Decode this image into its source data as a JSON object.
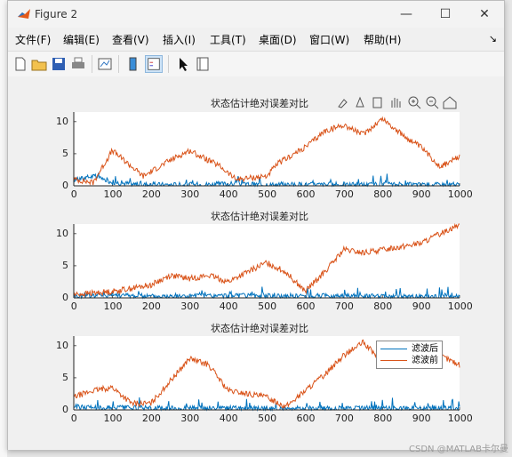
{
  "window": {
    "title": "Figure 2"
  },
  "menu": [
    "文件(F)",
    "编辑(E)",
    "查看(V)",
    "插入(I)",
    "工具(T)",
    "桌面(D)",
    "窗口(W)",
    "帮助(H)"
  ],
  "axes_toolbar_icons": [
    "brush-icon",
    "data-tip-icon",
    "legend-icon",
    "pan-icon",
    "zoom-in-icon",
    "zoom-out-icon",
    "home-icon"
  ],
  "watermark": "CSDN @MATLAB卡尔曼",
  "colors": {
    "filtered": "#0072BD",
    "raw": "#D95319"
  },
  "plots": [
    {
      "title": "状态估计绝对误差对比",
      "yticks": [
        "0",
        "5",
        "10"
      ],
      "xticks": [
        "0",
        "100",
        "200",
        "300",
        "400",
        "500",
        "600",
        "700",
        "800",
        "900",
        "1000"
      ]
    },
    {
      "title": "状态估计绝对误差对比",
      "yticks": [
        "0",
        "5",
        "10"
      ],
      "xticks": [
        "0",
        "100",
        "200",
        "300",
        "400",
        "500",
        "600",
        "700",
        "800",
        "900",
        "1000"
      ]
    },
    {
      "title": "状态估计绝对误差对比",
      "yticks": [
        "0",
        "5",
        "10"
      ],
      "xticks": [
        "0",
        "100",
        "200",
        "300",
        "400",
        "500",
        "600",
        "700",
        "800",
        "900",
        "1000"
      ],
      "legend": [
        "滤波后",
        "滤波前"
      ]
    }
  ],
  "chart_data": [
    {
      "type": "line",
      "title": "状态估计绝对误差对比",
      "xlim": [
        0,
        1000
      ],
      "ylim": [
        0,
        11
      ],
      "series": [
        {
          "name": "滤波后",
          "x": [
            0,
            50,
            100,
            150,
            200,
            300,
            400,
            500,
            600,
            700,
            800,
            900,
            1000
          ],
          "values": [
            1.5,
            2.5,
            1.0,
            0.5,
            0.3,
            0.3,
            0.5,
            0.3,
            0.3,
            0.3,
            0.3,
            0.3,
            0.3
          ]
        },
        {
          "name": "滤波前",
          "x": [
            0,
            50,
            100,
            150,
            180,
            250,
            300,
            380,
            420,
            500,
            530,
            600,
            650,
            700,
            750,
            800,
            850,
            900,
            950,
            1000
          ],
          "values": [
            1.0,
            0.5,
            5.5,
            3.0,
            1.5,
            4.0,
            5.5,
            3.0,
            1.0,
            1.5,
            3.5,
            6.0,
            8.5,
            9.5,
            8.0,
            10.5,
            8.0,
            6.0,
            3.0,
            4.5
          ]
        }
      ]
    },
    {
      "type": "line",
      "title": "状态估计绝对误差对比",
      "xlim": [
        0,
        1000
      ],
      "ylim": [
        0,
        12
      ],
      "series": [
        {
          "name": "滤波后",
          "x": [
            0,
            100,
            200,
            300,
            400,
            500,
            600,
            700,
            800,
            900,
            1000
          ],
          "values": [
            0.5,
            0.8,
            0.4,
            0.5,
            0.5,
            0.5,
            0.5,
            0.5,
            0.4,
            0.3,
            0.3
          ]
        },
        {
          "name": "滤波前",
          "x": [
            0,
            100,
            150,
            200,
            250,
            300,
            350,
            400,
            500,
            550,
            600,
            650,
            700,
            750,
            800,
            850,
            900,
            950,
            1000
          ],
          "values": [
            0.5,
            1.0,
            1.5,
            2.0,
            3.5,
            3.0,
            3.5,
            2.5,
            5.5,
            4.0,
            1.0,
            4.0,
            7.5,
            7.0,
            7.5,
            8.0,
            8.5,
            10.0,
            11.5
          ]
        }
      ]
    },
    {
      "type": "line",
      "title": "状态估计绝对误差对比",
      "xlim": [
        0,
        1000
      ],
      "ylim": [
        0,
        11
      ],
      "legend": "top-right",
      "series": [
        {
          "name": "滤波后",
          "x": [
            0,
            100,
            200,
            300,
            400,
            500,
            600,
            700,
            800,
            900,
            1000
          ],
          "values": [
            0.8,
            0.6,
            0.4,
            0.4,
            0.4,
            0.4,
            0.4,
            0.4,
            0.4,
            0.4,
            0.4
          ]
        },
        {
          "name": "滤波前",
          "x": [
            0,
            50,
            100,
            150,
            200,
            250,
            300,
            350,
            400,
            500,
            550,
            600,
            650,
            700,
            750,
            800,
            850,
            900,
            950,
            1000
          ],
          "values": [
            2.0,
            3.0,
            3.5,
            1.0,
            1.0,
            4.5,
            8.0,
            7.0,
            3.0,
            2.0,
            0.5,
            3.0,
            5.5,
            8.5,
            10.5,
            7.5,
            9.0,
            8.0,
            8.5,
            7.0
          ]
        }
      ]
    }
  ]
}
